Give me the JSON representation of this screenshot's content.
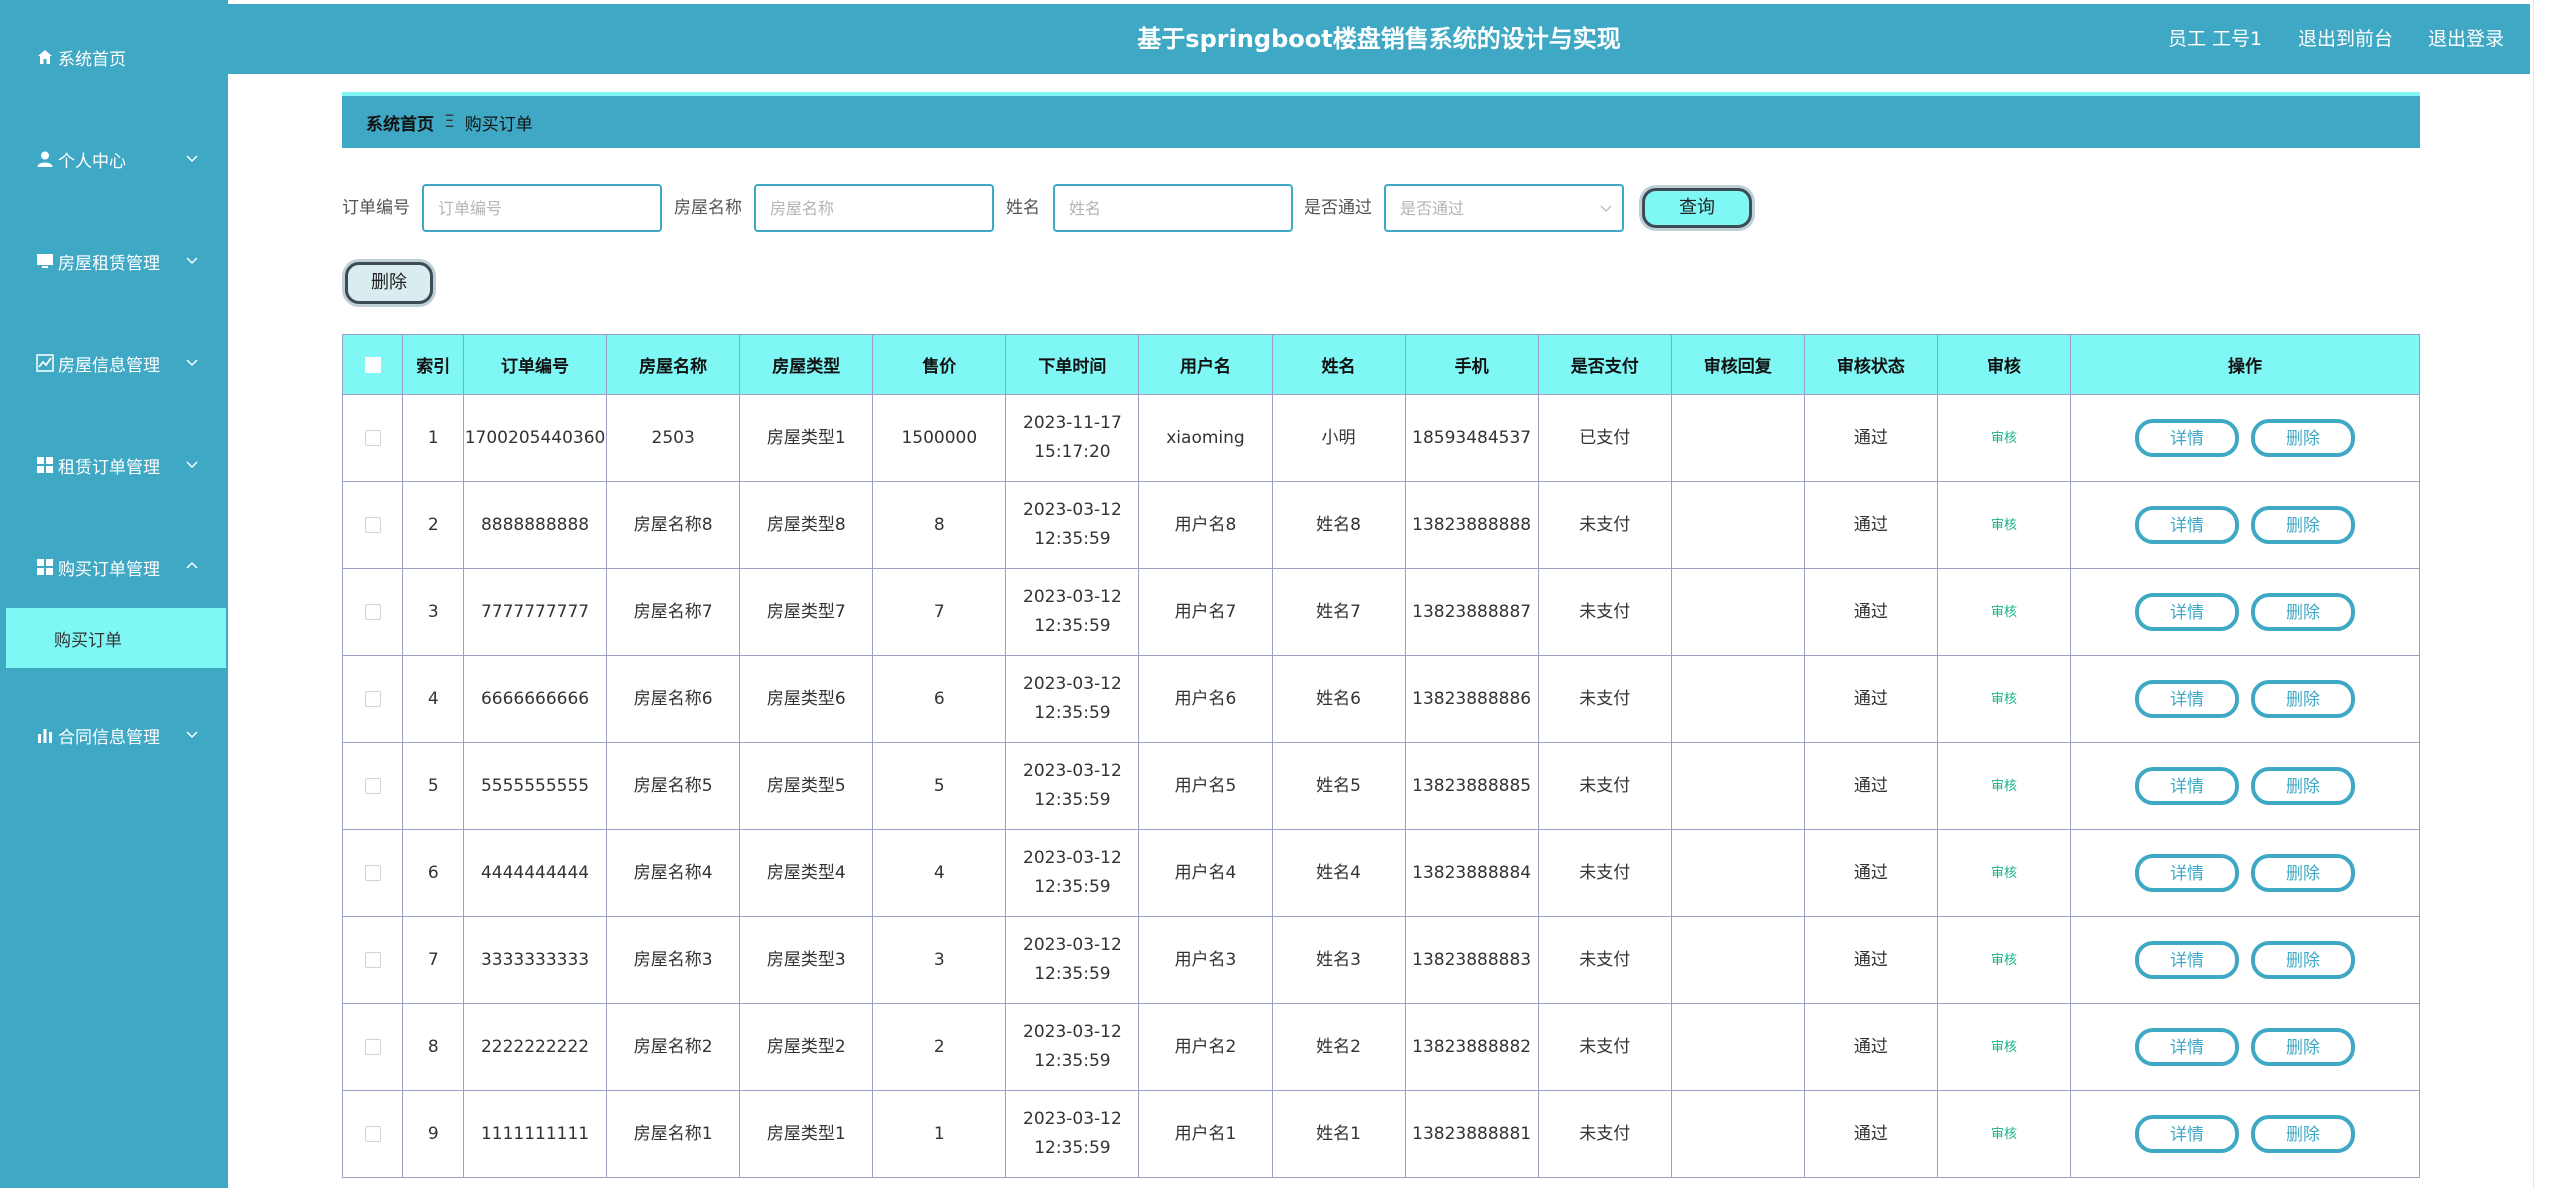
{
  "header": {
    "title": "基于springboot楼盘销售系统的设计与实现",
    "user": "员工 工号1",
    "to_front": "退出到前台",
    "logout": "退出登录"
  },
  "sidebar": {
    "items": [
      {
        "label": "系统首页",
        "icon": "home-icon"
      },
      {
        "label": "个人中心",
        "icon": "user-icon"
      },
      {
        "label": "房屋租赁管理",
        "icon": "monitor-icon"
      },
      {
        "label": "房屋信息管理",
        "icon": "chart-line-icon"
      },
      {
        "label": "租赁订单管理",
        "icon": "grid-icon"
      },
      {
        "label": "购买订单管理",
        "icon": "grid-icon"
      },
      {
        "label": "合同信息管理",
        "icon": "bar-chart-icon"
      }
    ],
    "active_sub": "购买订单"
  },
  "breadcrumb": {
    "home": "系统首页",
    "separator": "Ξ",
    "current": "购买订单"
  },
  "search": {
    "order_no_label": "订单编号",
    "order_no_placeholder": "订单编号",
    "house_name_label": "房屋名称",
    "house_name_placeholder": "房屋名称",
    "name_label": "姓名",
    "name_placeholder": "姓名",
    "approved_label": "是否通过",
    "approved_placeholder": "是否通过",
    "query_button": "查询"
  },
  "toolbar": {
    "delete_button": "删除"
  },
  "table": {
    "columns": [
      "索引",
      "订单编号",
      "房屋名称",
      "房屋类型",
      "售价",
      "下单时间",
      "用户名",
      "姓名",
      "手机",
      "是否支付",
      "审核回复",
      "审核状态",
      "审核",
      "操作"
    ],
    "action_detail": "详情",
    "action_delete": "删除",
    "audit_label": "审核",
    "rows": [
      {
        "idx": "1",
        "order_no": "1700205440360",
        "house_name": "2503",
        "house_type": "房屋类型1",
        "price": "1500000",
        "time": "2023-11-17 15:17:20",
        "username": "xiaoming",
        "name": "小明",
        "phone": "18593484537",
        "paid": "已支付",
        "reply": "",
        "status": "通过"
      },
      {
        "idx": "2",
        "order_no": "8888888888",
        "house_name": "房屋名称8",
        "house_type": "房屋类型8",
        "price": "8",
        "time": "2023-03-12 12:35:59",
        "username": "用户名8",
        "name": "姓名8",
        "phone": "13823888888",
        "paid": "未支付",
        "reply": "",
        "status": "通过"
      },
      {
        "idx": "3",
        "order_no": "7777777777",
        "house_name": "房屋名称7",
        "house_type": "房屋类型7",
        "price": "7",
        "time": "2023-03-12 12:35:59",
        "username": "用户名7",
        "name": "姓名7",
        "phone": "13823888887",
        "paid": "未支付",
        "reply": "",
        "status": "通过"
      },
      {
        "idx": "4",
        "order_no": "6666666666",
        "house_name": "房屋名称6",
        "house_type": "房屋类型6",
        "price": "6",
        "time": "2023-03-12 12:35:59",
        "username": "用户名6",
        "name": "姓名6",
        "phone": "13823888886",
        "paid": "未支付",
        "reply": "",
        "status": "通过"
      },
      {
        "idx": "5",
        "order_no": "5555555555",
        "house_name": "房屋名称5",
        "house_type": "房屋类型5",
        "price": "5",
        "time": "2023-03-12 12:35:59",
        "username": "用户名5",
        "name": "姓名5",
        "phone": "13823888885",
        "paid": "未支付",
        "reply": "",
        "status": "通过"
      },
      {
        "idx": "6",
        "order_no": "4444444444",
        "house_name": "房屋名称4",
        "house_type": "房屋类型4",
        "price": "4",
        "time": "2023-03-12 12:35:59",
        "username": "用户名4",
        "name": "姓名4",
        "phone": "13823888884",
        "paid": "未支付",
        "reply": "",
        "status": "通过"
      },
      {
        "idx": "7",
        "order_no": "3333333333",
        "house_name": "房屋名称3",
        "house_type": "房屋类型3",
        "price": "3",
        "time": "2023-03-12 12:35:59",
        "username": "用户名3",
        "name": "姓名3",
        "phone": "13823888883",
        "paid": "未支付",
        "reply": "",
        "status": "通过"
      },
      {
        "idx": "8",
        "order_no": "2222222222",
        "house_name": "房屋名称2",
        "house_type": "房屋类型2",
        "price": "2",
        "time": "2023-03-12 12:35:59",
        "username": "用户名2",
        "name": "姓名2",
        "phone": "13823888882",
        "paid": "未支付",
        "reply": "",
        "status": "通过"
      },
      {
        "idx": "9",
        "order_no": "1111111111",
        "house_name": "房屋名称1",
        "house_type": "房屋类型1",
        "price": "1",
        "time": "2023-03-12 12:35:59",
        "username": "用户名1",
        "name": "姓名1",
        "phone": "13823888881",
        "paid": "未支付",
        "reply": "",
        "status": "通过"
      }
    ]
  }
}
